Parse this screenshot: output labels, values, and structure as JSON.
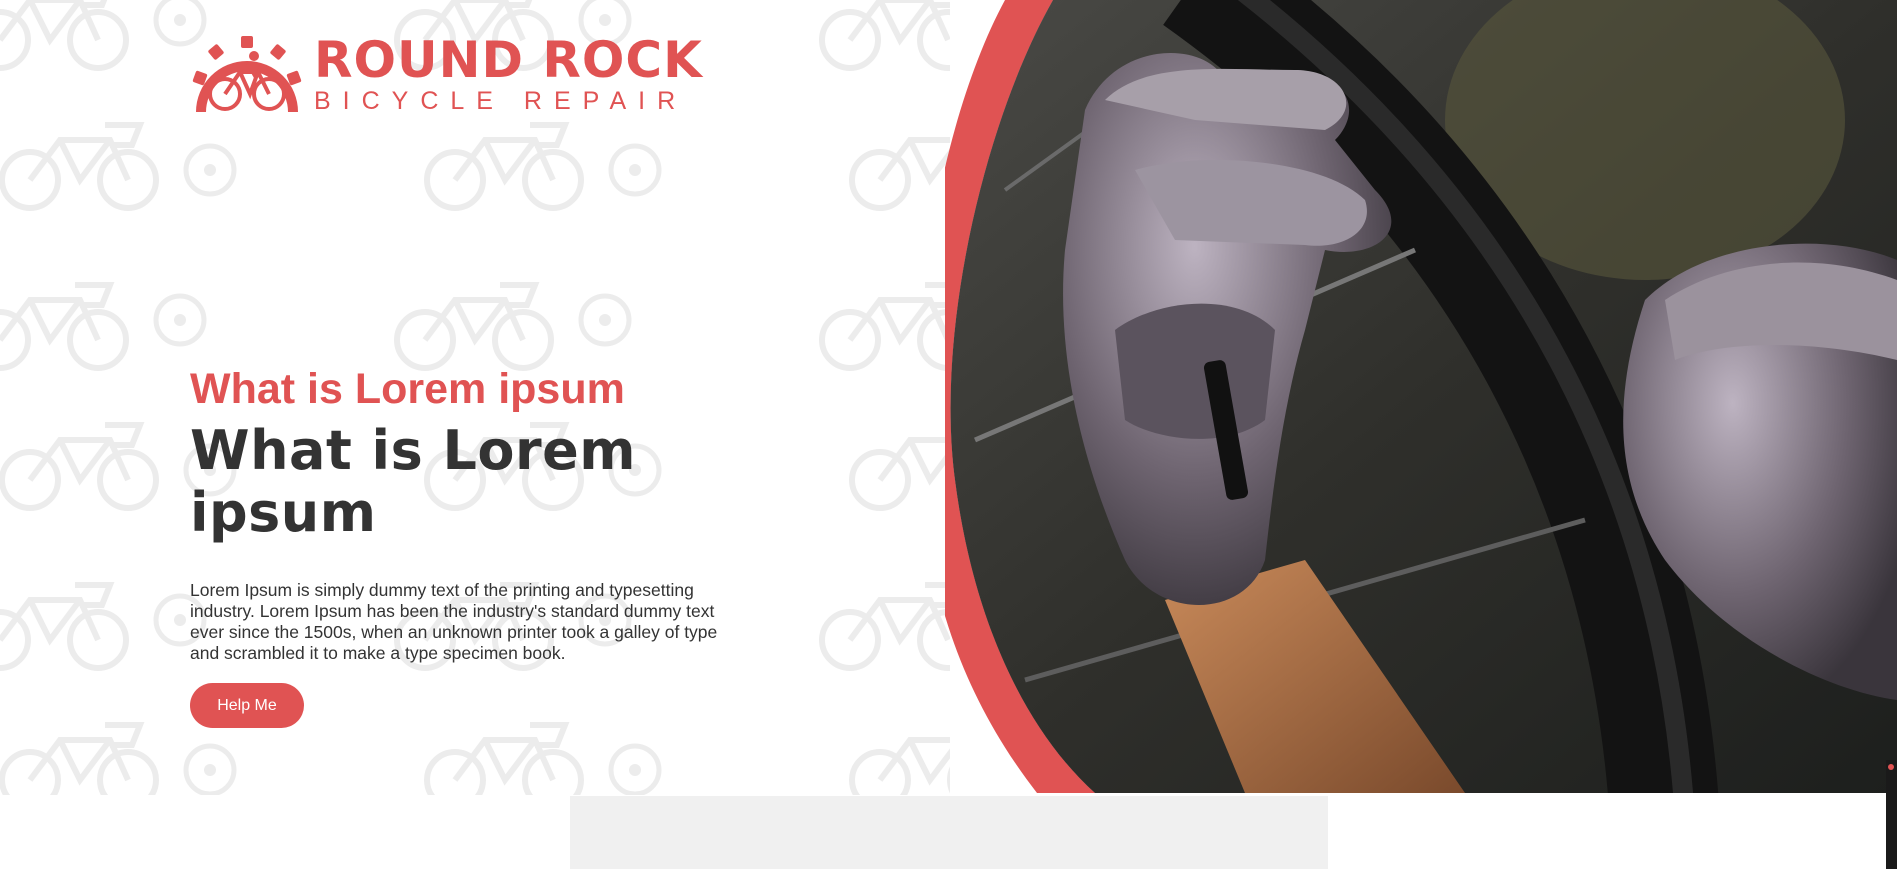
{
  "brand": {
    "title": "ROUND ROCK",
    "subtitle": "BICYCLE REPAIR",
    "logo_icon": "gear-bicycle-rider-icon"
  },
  "hero": {
    "kicker": "What is Lorem ipsum",
    "title": "What is Lorem ipsum",
    "body": "Lorem Ipsum is simply dummy text of the printing and typesetting industry. Lorem Ipsum has been the industry's standard dummy text ever since the 1500s, when an unknown printer took a galley of type and scrambled it to make a type specimen book.",
    "button_label": "Help Me",
    "image": "gloved-hands-fixing-bicycle-wheel-photo"
  },
  "section": {
    "heading_fragment": ""
  },
  "colors": {
    "accent": "#e05353",
    "text_dark": "#333333",
    "pattern": "#ececec",
    "panel": "#f0f0f0"
  }
}
